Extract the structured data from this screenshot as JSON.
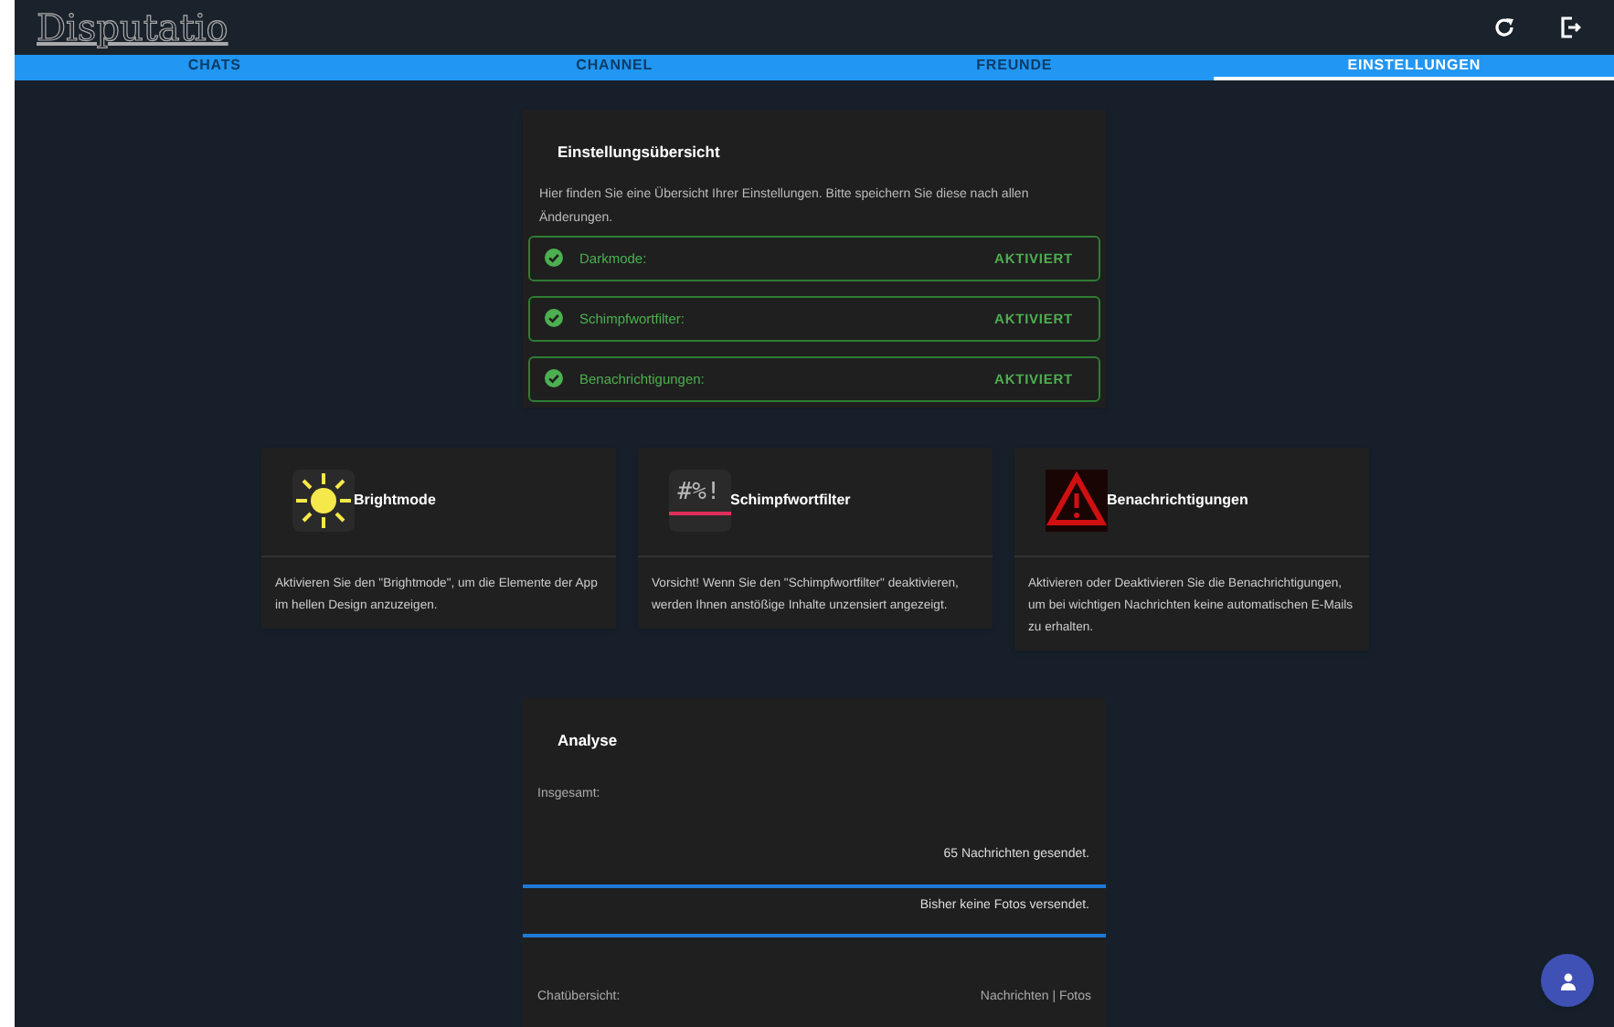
{
  "app_title": "Disputatio",
  "tabs": [
    {
      "label": "CHATS",
      "selected": false
    },
    {
      "label": "CHANNEL",
      "selected": false
    },
    {
      "label": "FREUNDE",
      "selected": false
    },
    {
      "label": "EINSTELLUNGEN",
      "selected": true
    }
  ],
  "overview": {
    "title": "Einstellungsübersicht",
    "description": "Hier finden Sie eine Übersicht Ihrer Einstellungen. Bitte speichern Sie diese nach allen Änderungen.",
    "settings": [
      {
        "label": "Darkmode:",
        "status": "AKTIVIERT",
        "active": true
      },
      {
        "label": "Schimpfwortfilter:",
        "status": "AKTIVIERT",
        "active": true
      },
      {
        "label": "Benachrichtigungen:",
        "status": "AKTIVIERT",
        "active": true
      }
    ]
  },
  "features": [
    {
      "kind": "sun",
      "title": "Brightmode",
      "text": "Aktivieren Sie den \"Brightmode\", um die Elemente der App im hellen Design anzuzeigen."
    },
    {
      "kind": "symbols",
      "title": "Schimpfwortfilter",
      "text": "Vorsicht! Wenn Sie den \"Schimpfwortfilter\" deaktivieren, werden Ihnen anstößige Inhalte unzensiert angezeigt.",
      "icon_text": "#%!"
    },
    {
      "kind": "warning",
      "title": "Benachrichtigungen",
      "text": "Aktivieren oder Deaktivieren Sie die Benachrichtigungen, um bei wichtigen Nachrichten keine automatischen E-Mails zu erhalten."
    }
  ],
  "analysis": {
    "title": "Analyse",
    "total_label": "Insgesamt:",
    "stats": [
      {
        "text": "65 Nachrichten gesendet.",
        "level": 1
      },
      {
        "text": "Bisher keine Fotos versendet.",
        "level": 1
      }
    ],
    "chat_label": "Chatübersicht:",
    "chat_columns": "Nachrichten | Fotos"
  }
}
